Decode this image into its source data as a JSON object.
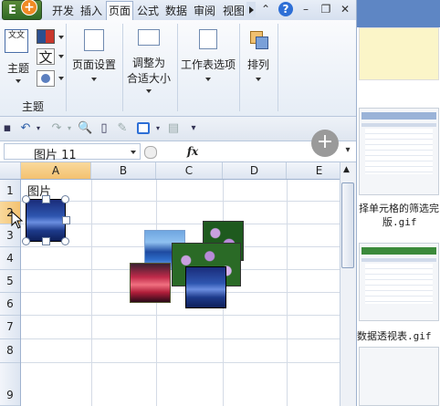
{
  "tabs": [
    "开发",
    "插入",
    "页面",
    "公式",
    "数据",
    "审阅",
    "视图"
  ],
  "active_tab_index": 2,
  "ribbon": {
    "theme_group_label": "主题",
    "theme_button_label": "主题",
    "theme_icon_text": "文文",
    "page_setup_label": "页面设置",
    "fit_to_label_line1": "调整为",
    "fit_to_label_line2": "合适大小",
    "sheet_options_label": "工作表选项",
    "arrange_label": "排列"
  },
  "name_box": {
    "value": "图片 11"
  },
  "formula_bar": {
    "fx_label": "fx"
  },
  "columns": [
    "A",
    "B",
    "C",
    "D",
    "E"
  ],
  "selected_column": "A",
  "rows": [
    "1",
    "2",
    "3",
    "4",
    "5",
    "6",
    "7",
    "8",
    "9"
  ],
  "selected_row": "2",
  "cells": {
    "A1": "图片"
  },
  "right_panel": {
    "caption1_line1": "择单元格的筛选完",
    "caption1_line2": "版.gif",
    "caption2": "数据透视表.gif"
  },
  "colors": {
    "accent": "#2e6fd6",
    "selected_header": "#f3c170",
    "ribbon_bg": "#e6edf6",
    "grid_line": "#d4dbe6"
  }
}
